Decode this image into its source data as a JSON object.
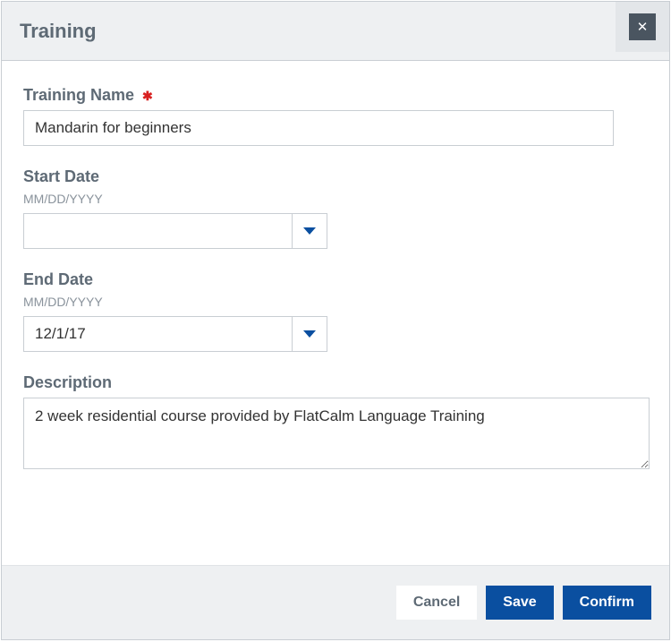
{
  "dialog": {
    "title": "Training",
    "close_symbol": "✕"
  },
  "fields": {
    "training_name": {
      "label": "Training Name",
      "value": "Mandarin for beginners",
      "required_mark": "✱"
    },
    "start_date": {
      "label": "Start Date",
      "hint": "MM/DD/YYYY",
      "value": ""
    },
    "end_date": {
      "label": "End Date",
      "hint": "MM/DD/YYYY",
      "value": "12/1/17"
    },
    "description": {
      "label": "Description",
      "value": "2 week residential course provided by FlatCalm Language Training"
    }
  },
  "footer": {
    "cancel": "Cancel",
    "save": "Save",
    "confirm": "Confirm"
  }
}
